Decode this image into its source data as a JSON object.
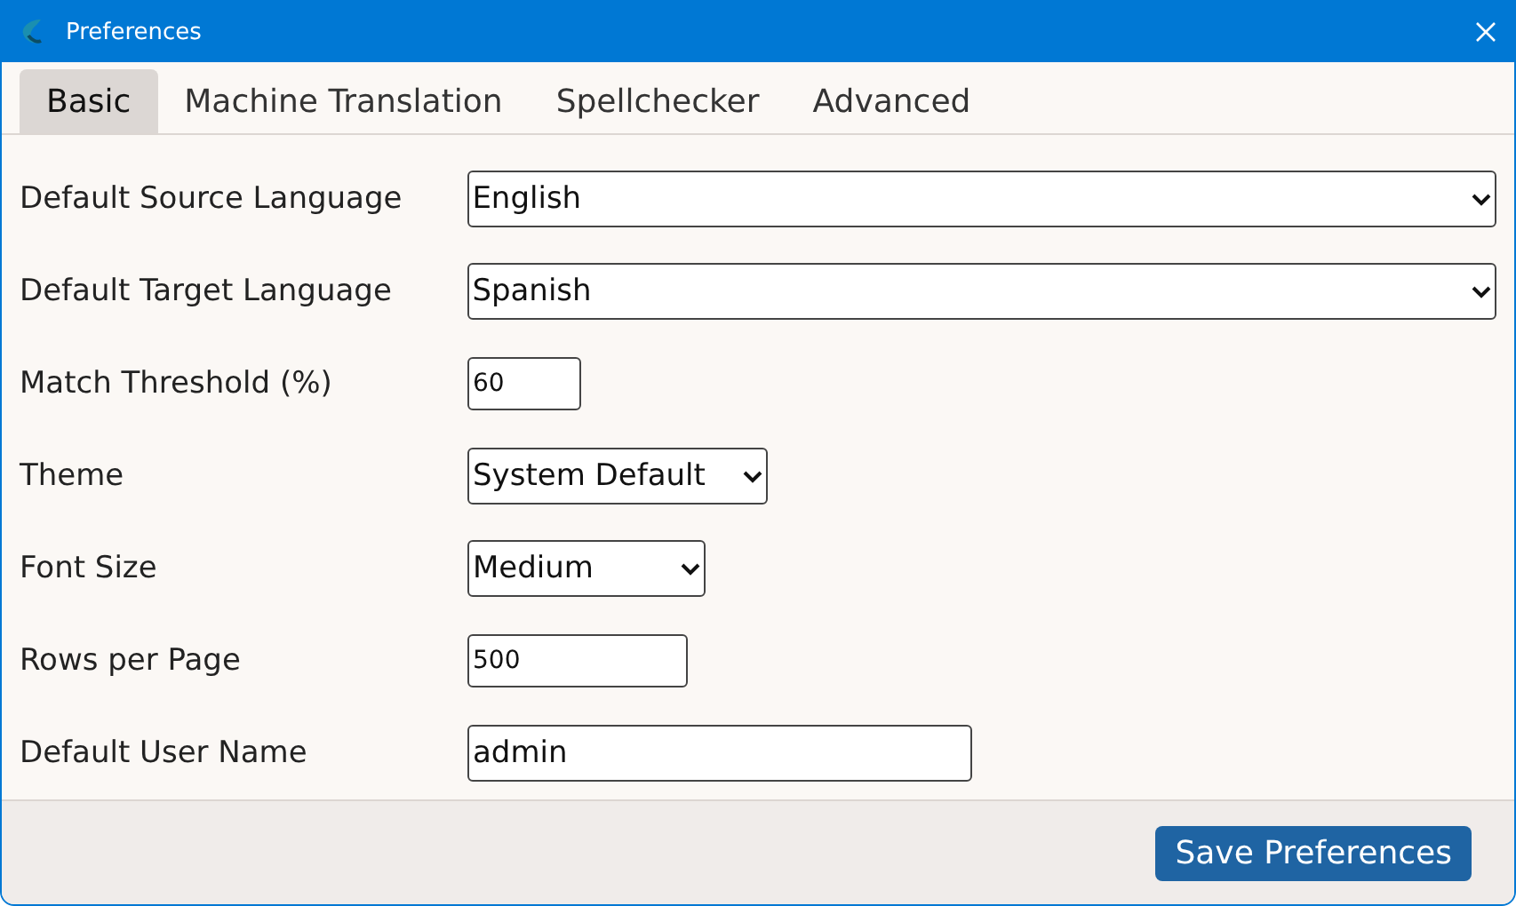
{
  "window": {
    "title": "Preferences"
  },
  "tabs": [
    {
      "label": "Basic",
      "selected": true
    },
    {
      "label": "Machine Translation",
      "selected": false
    },
    {
      "label": "Spellchecker",
      "selected": false
    },
    {
      "label": "Advanced",
      "selected": false
    }
  ],
  "fields": [
    {
      "label": "Default Source Language",
      "kind": "select",
      "value": "English"
    },
    {
      "label": "Default Target Language",
      "kind": "select",
      "value": "Spanish"
    },
    {
      "label": "Match Threshold (%)",
      "kind": "input",
      "value": "60"
    },
    {
      "label": "Theme",
      "kind": "select",
      "value": "System Default"
    },
    {
      "label": "Font Size",
      "kind": "select",
      "value": "Medium"
    },
    {
      "label": "Rows per Page",
      "kind": "input",
      "value": "500"
    },
    {
      "label": "Default User Name",
      "kind": "input",
      "value": "admin"
    }
  ],
  "buttons": [
    "Save Preferences"
  ]
}
